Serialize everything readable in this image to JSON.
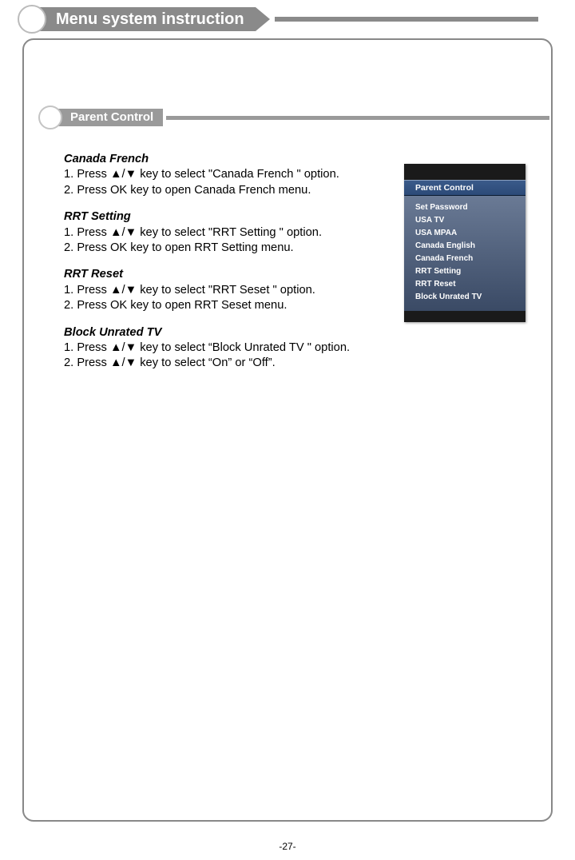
{
  "title": "Menu system instruction",
  "subtitle": "Parent  Control",
  "sections": [
    {
      "heading": "Canada French",
      "lines": [
        "1. Press ▲/▼ key to select \"Canada French \" option.",
        "2. Press OK key to open Canada French menu."
      ]
    },
    {
      "heading": "RRT Setting",
      "lines": [
        "1. Press ▲/▼ key to select \"RRT Setting \" option.",
        "2. Press OK key to open RRT Setting menu."
      ]
    },
    {
      "heading": "RRT Reset",
      "lines": [
        "1. Press ▲/▼ key to select \"RRT Seset \" option.",
        "2. Press OK  key to open RRT Seset menu."
      ]
    },
    {
      "heading": "Block Unrated TV",
      "lines": [
        "1. Press ▲/▼ key to select “Block Unrated TV \" option.",
        "2. Press ▲/▼ key to select  “On” or “Off”."
      ]
    }
  ],
  "menu": {
    "header": "Parent  Control",
    "items": [
      "Set Password",
      "USA TV",
      "USA MPAA",
      "Canada English",
      "Canada French",
      "RRT Setting",
      "RRT Reset",
      "Block Unrated TV"
    ]
  },
  "page_number": "-27-"
}
